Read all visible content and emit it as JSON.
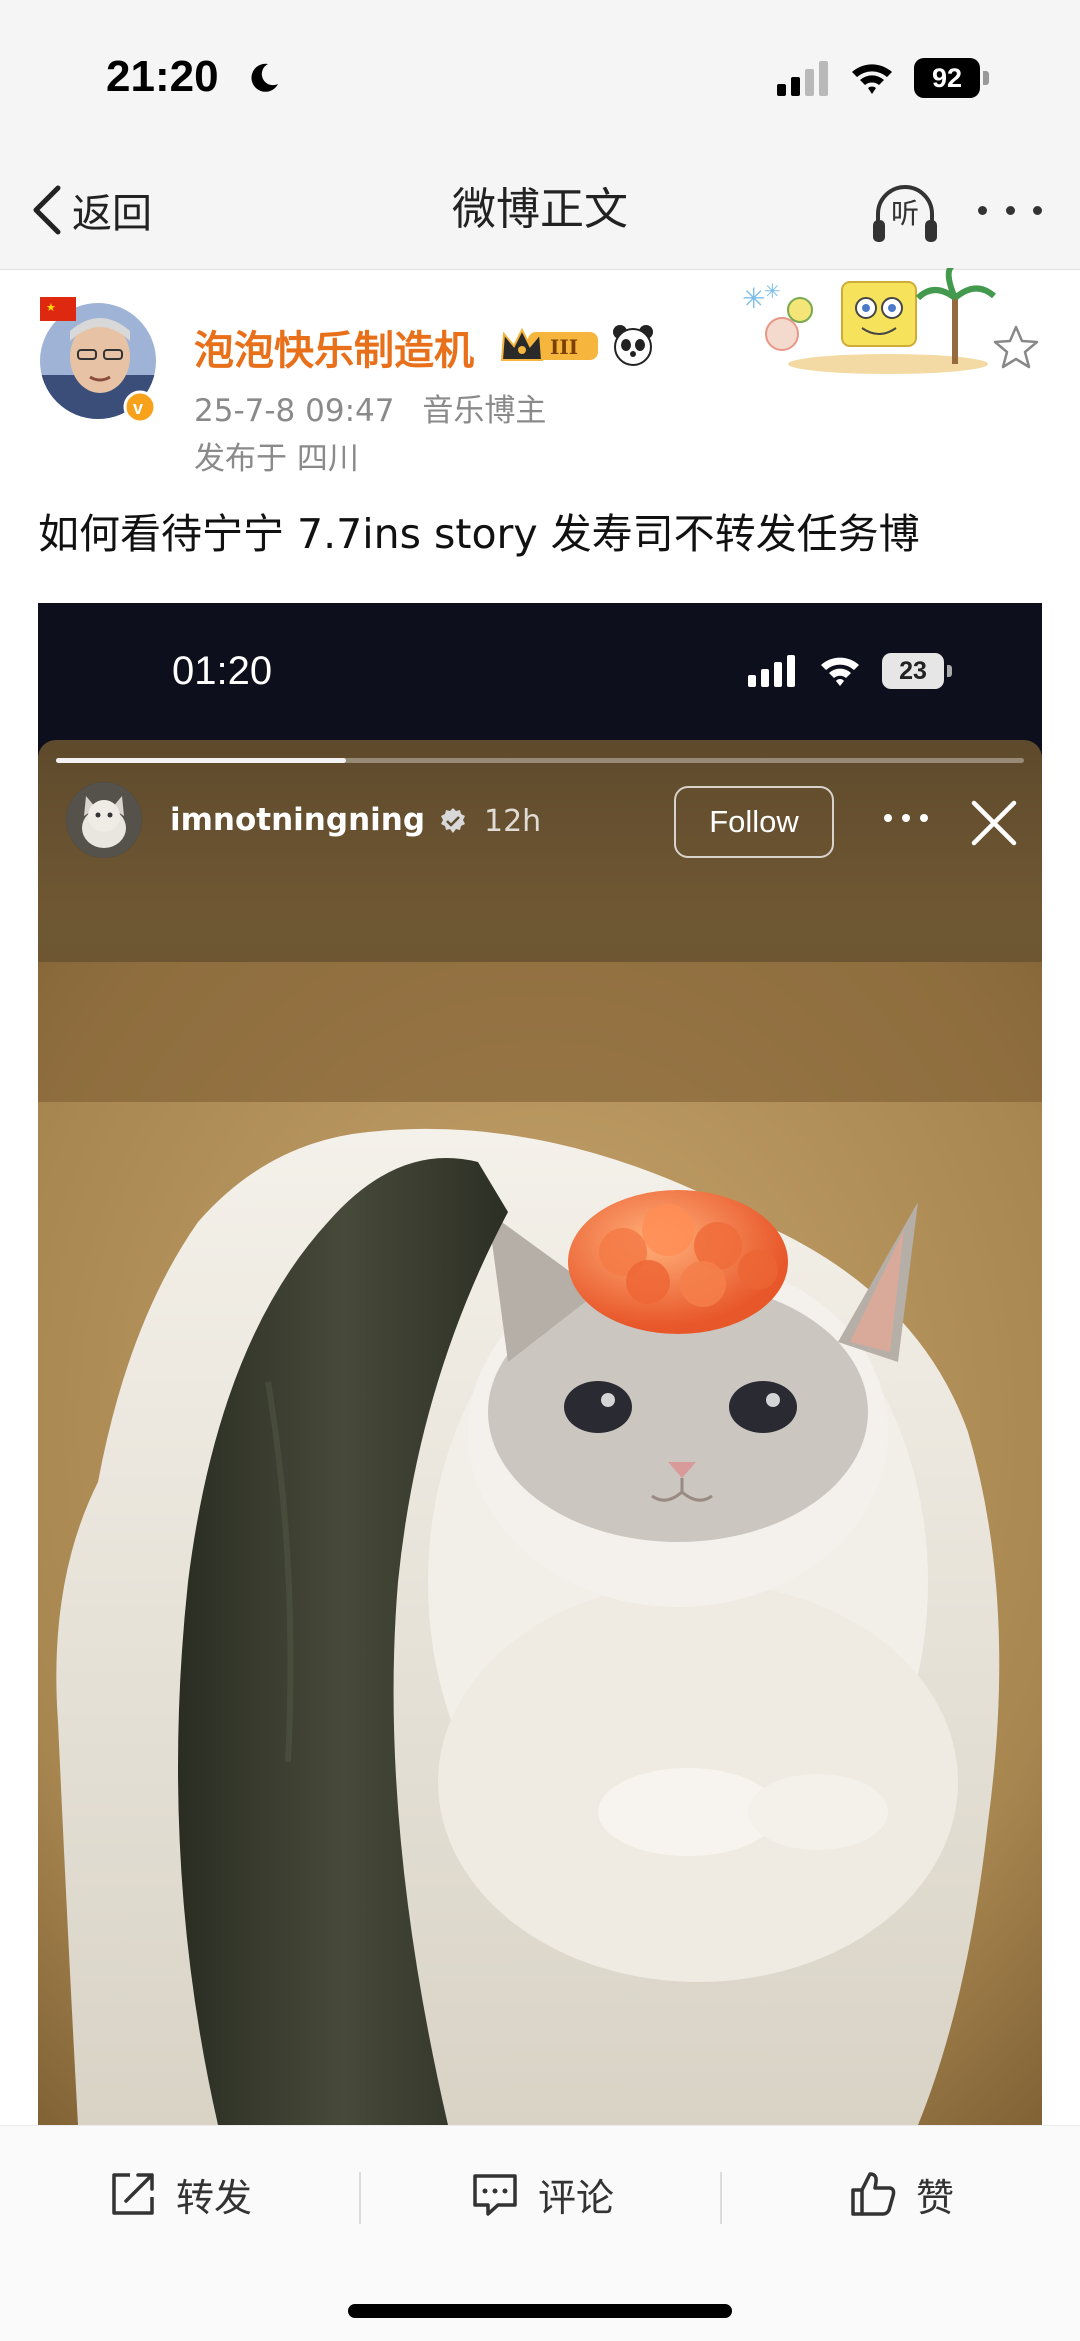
{
  "status_bar": {
    "time": "21:20",
    "battery": "92"
  },
  "nav": {
    "back_label": "返回",
    "title": "微博正文",
    "listen_label": "听"
  },
  "post": {
    "author": "泡泡快乐制造机",
    "date": "25-7-8 09:47",
    "role": "音乐博主",
    "location": "发布于 四川",
    "text": "如何看待宁宁 7.7ins story 发寿司不转发任务博"
  },
  "embed": {
    "status_time": "01:20",
    "battery": "23",
    "story": {
      "username": "imnotningning",
      "age": "12h",
      "follow_label": "Follow",
      "progress": 0.3
    }
  },
  "actions": {
    "repost": "转发",
    "comment": "评论",
    "like": "赞"
  },
  "colors": {
    "author": "#e8701a",
    "background": "#f5f5f5"
  }
}
